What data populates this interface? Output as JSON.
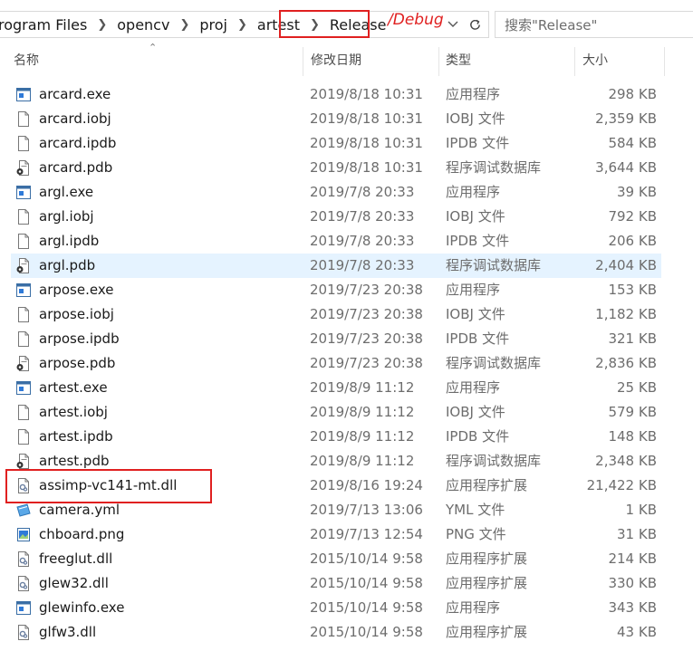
{
  "address": {
    "crumbs": [
      "rogram Files",
      "opencv",
      "proj",
      "artest",
      "Release"
    ]
  },
  "annotation": {
    "debug_note": "/Debug"
  },
  "search": {
    "placeholder": "搜索\"Release\""
  },
  "columns": {
    "name": "名称",
    "date": "修改日期",
    "type": "类型",
    "size": "大小"
  },
  "colors": {
    "highlight_red": "#e02020",
    "hover_row": "#e5f3ff"
  },
  "files": [
    {
      "name": "arcard.exe",
      "date": "2019/8/18 10:31",
      "type": "应用程序",
      "size": "298 KB",
      "icon": "exe-icon"
    },
    {
      "name": "arcard.iobj",
      "date": "2019/8/18 10:31",
      "type": "IOBJ 文件",
      "size": "2,359 KB",
      "icon": "file-icon"
    },
    {
      "name": "arcard.ipdb",
      "date": "2019/8/18 10:31",
      "type": "IPDB 文件",
      "size": "584 KB",
      "icon": "file-icon"
    },
    {
      "name": "arcard.pdb",
      "date": "2019/8/18 10:31",
      "type": "程序调试数据库",
      "size": "3,644 KB",
      "icon": "pdb-icon"
    },
    {
      "name": "argl.exe",
      "date": "2019/7/8 20:33",
      "type": "应用程序",
      "size": "39 KB",
      "icon": "exe-icon"
    },
    {
      "name": "argl.iobj",
      "date": "2019/7/8 20:33",
      "type": "IOBJ 文件",
      "size": "792 KB",
      "icon": "file-icon"
    },
    {
      "name": "argl.ipdb",
      "date": "2019/7/8 20:33",
      "type": "IPDB 文件",
      "size": "206 KB",
      "icon": "file-icon"
    },
    {
      "name": "argl.pdb",
      "date": "2019/7/8 20:33",
      "type": "程序调试数据库",
      "size": "2,404 KB",
      "icon": "pdb-icon",
      "hover": true
    },
    {
      "name": "arpose.exe",
      "date": "2019/7/23 20:38",
      "type": "应用程序",
      "size": "153 KB",
      "icon": "exe-icon"
    },
    {
      "name": "arpose.iobj",
      "date": "2019/7/23 20:38",
      "type": "IOBJ 文件",
      "size": "1,182 KB",
      "icon": "file-icon"
    },
    {
      "name": "arpose.ipdb",
      "date": "2019/7/23 20:38",
      "type": "IPDB 文件",
      "size": "321 KB",
      "icon": "file-icon"
    },
    {
      "name": "arpose.pdb",
      "date": "2019/7/23 20:38",
      "type": "程序调试数据库",
      "size": "2,836 KB",
      "icon": "pdb-icon"
    },
    {
      "name": "artest.exe",
      "date": "2019/8/9 11:12",
      "type": "应用程序",
      "size": "25 KB",
      "icon": "exe-icon"
    },
    {
      "name": "artest.iobj",
      "date": "2019/8/9 11:12",
      "type": "IOBJ 文件",
      "size": "579 KB",
      "icon": "file-icon"
    },
    {
      "name": "artest.ipdb",
      "date": "2019/8/9 11:12",
      "type": "IPDB 文件",
      "size": "148 KB",
      "icon": "file-icon"
    },
    {
      "name": "artest.pdb",
      "date": "2019/8/9 11:12",
      "type": "程序调试数据库",
      "size": "2,348 KB",
      "icon": "pdb-icon"
    },
    {
      "name": "assimp-vc141-mt.dll",
      "date": "2019/8/16 19:24",
      "type": "应用程序扩展",
      "size": "21,422 KB",
      "icon": "dll-icon"
    },
    {
      "name": "camera.yml",
      "date": "2019/7/13 13:06",
      "type": "YML 文件",
      "size": "1 KB",
      "icon": "yml-icon"
    },
    {
      "name": "chboard.png",
      "date": "2019/7/13 12:54",
      "type": "PNG 文件",
      "size": "31 KB",
      "icon": "png-icon"
    },
    {
      "name": "freeglut.dll",
      "date": "2015/10/14 9:58",
      "type": "应用程序扩展",
      "size": "214 KB",
      "icon": "dll-icon"
    },
    {
      "name": "glew32.dll",
      "date": "2015/10/14 9:58",
      "type": "应用程序扩展",
      "size": "330 KB",
      "icon": "dll-icon"
    },
    {
      "name": "glewinfo.exe",
      "date": "2015/10/14 9:58",
      "type": "应用程序",
      "size": "343 KB",
      "icon": "exe-icon"
    },
    {
      "name": "glfw3.dll",
      "date": "2015/10/14 9:58",
      "type": "应用程序扩展",
      "size": "43 KB",
      "icon": "dll-icon"
    }
  ]
}
